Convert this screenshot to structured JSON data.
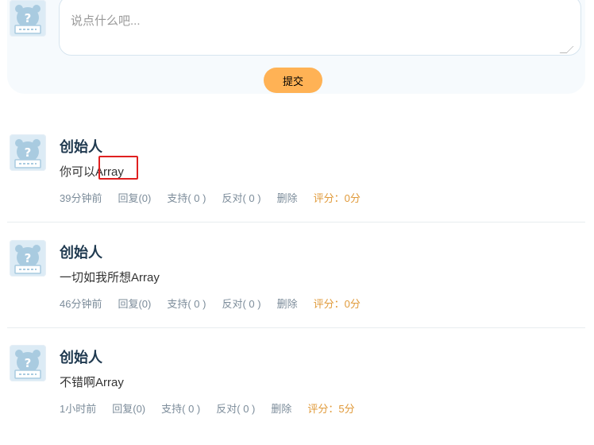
{
  "composer": {
    "placeholder": "说点什么吧...",
    "submit_label": "提交"
  },
  "comments": [
    {
      "author": "创始人",
      "text": "你可以Array",
      "time": "39分钟前",
      "reply": "回复(0)",
      "support": "支持( 0 )",
      "oppose": "反对( 0 )",
      "delete": "删除",
      "score": "评分：0分"
    },
    {
      "author": "创始人",
      "text": "一切如我所想Array",
      "time": "46分钟前",
      "reply": "回复(0)",
      "support": "支持( 0 )",
      "oppose": "反对( 0 )",
      "delete": "删除",
      "score": "评分：0分"
    },
    {
      "author": "创始人",
      "text": "不错啊Array",
      "time": "1小时前",
      "reply": "回复(0)",
      "support": "支持( 0 )",
      "oppose": "反对( 0 )",
      "delete": "删除",
      "score": "评分：5分"
    }
  ],
  "avatar_icon": "question-mark-bear-avatar",
  "colors": {
    "accent": "#ffb255",
    "score": "#e09a3a",
    "author": "#203a50",
    "highlight": "#e02020"
  }
}
